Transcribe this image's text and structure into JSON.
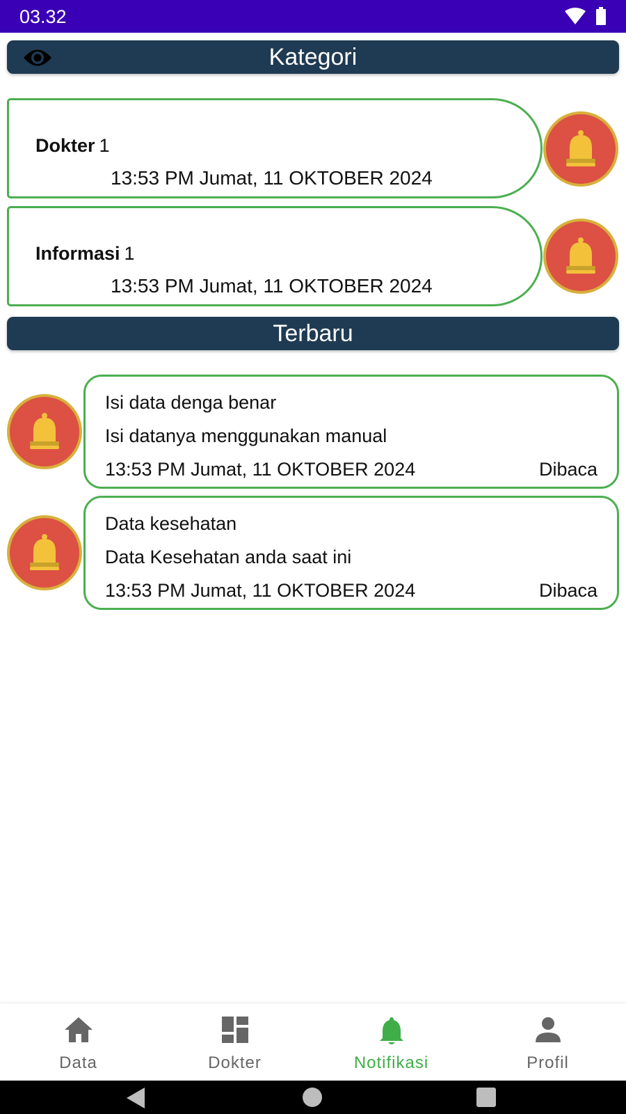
{
  "status_bar": {
    "time": "03.32",
    "bg_color": "#3a00b5"
  },
  "sections": {
    "kategori_title": "Kategori",
    "terbaru_title": "Terbaru"
  },
  "kategori": [
    {
      "name": "Dokter",
      "count": "1",
      "time": "13:53 PM Jumat, 11 OKTOBER 2024",
      "icon": "bell-icon"
    },
    {
      "name": "Informasi",
      "count": "1",
      "time": "13:53 PM Jumat, 11 OKTOBER 2024",
      "icon": "bell-icon"
    }
  ],
  "terbaru": [
    {
      "title": "Isi data denga benar",
      "description": "Isi datanya menggunakan manual",
      "time": "13:53 PM Jumat, 11 OKTOBER 2024",
      "status": "Dibaca",
      "icon": "bell-icon"
    },
    {
      "title": "Data kesehatan",
      "description": "Data Kesehatan anda saat ini",
      "time": "13:53 PM Jumat, 11 OKTOBER 2024",
      "status": "Dibaca",
      "icon": "bell-icon"
    }
  ],
  "bottom_nav": [
    {
      "label": "Data",
      "icon": "home-icon",
      "active": false
    },
    {
      "label": "Dokter",
      "icon": "dashboard-icon",
      "active": false
    },
    {
      "label": "Notifikasi",
      "icon": "bell-icon",
      "active": true
    },
    {
      "label": "Profil",
      "icon": "person-icon",
      "active": false
    }
  ],
  "colors": {
    "header_bar": "#1f3b53",
    "card_border": "#4caf50",
    "bell_bg": "#dc5143",
    "bell_ring": "#d8b03b",
    "active_nav": "#3fae49"
  }
}
